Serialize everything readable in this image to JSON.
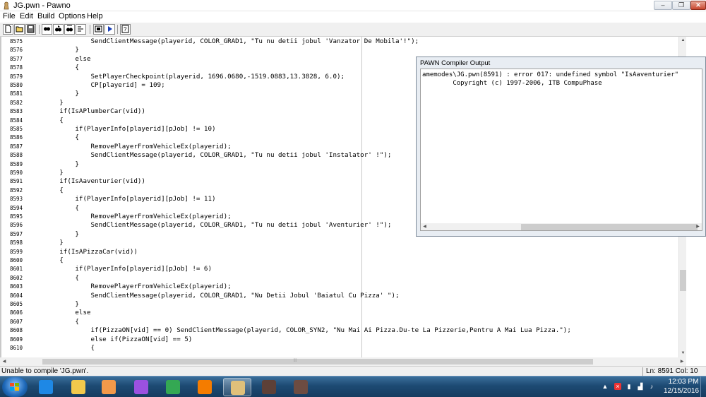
{
  "window": {
    "title": "JG.pwn - Pawno",
    "minimize": "–",
    "maximize": "❐",
    "close": "✕"
  },
  "menu": [
    "File",
    "Edit",
    "Build",
    "Options",
    "Help"
  ],
  "toolbar": {
    "buttons": [
      {
        "name": "new-file-icon",
        "glyph": "▫"
      },
      {
        "name": "open-file-icon",
        "glyph": "▭"
      },
      {
        "name": "save-icon",
        "glyph": "▪"
      },
      {
        "name": "find-icon",
        "glyph": "⚲"
      },
      {
        "name": "find-next-icon",
        "glyph": "⚲"
      },
      {
        "name": "replace-icon",
        "glyph": "⚲"
      },
      {
        "name": "goto-icon",
        "glyph": "⇥"
      },
      {
        "name": "function-list-icon",
        "glyph": "▣"
      },
      {
        "name": "compile-icon",
        "glyph": "▶"
      },
      {
        "name": "help-icon",
        "glyph": "?"
      }
    ]
  },
  "editor": {
    "lines": [
      {
        "n": "8575",
        "code": "                SendClientMessage(playerid, COLOR_GRAD1, \"Tu nu detii jobul 'Vanzator De Mobila'!\");"
      },
      {
        "n": "8576",
        "code": "            }"
      },
      {
        "n": "8577",
        "code": "            else"
      },
      {
        "n": "8578",
        "code": "            {"
      },
      {
        "n": "8579",
        "code": "                SetPlayerCheckpoint(playerid, 1696.0680,-1519.0883,13.3828, 6.0);"
      },
      {
        "n": "8580",
        "code": "                CP[playerid] = 109;"
      },
      {
        "n": "8581",
        "code": "            }"
      },
      {
        "n": "8582",
        "code": "        }"
      },
      {
        "n": "8583",
        "code": "        if(IsAPlumberCar(vid))"
      },
      {
        "n": "8584",
        "code": "        {"
      },
      {
        "n": "8585",
        "code": "            if(PlayerInfo[playerid][pJob] != 10)"
      },
      {
        "n": "8586",
        "code": "            {"
      },
      {
        "n": "8587",
        "code": "                RemovePlayerFromVehicleEx(playerid);"
      },
      {
        "n": "8588",
        "code": "                SendClientMessage(playerid, COLOR_GRAD1, \"Tu nu detii jobul 'Instalator' !\");"
      },
      {
        "n": "8589",
        "code": "            }"
      },
      {
        "n": "8590",
        "code": "        }"
      },
      {
        "n": "8591",
        "code": "        if(IsAaventurier(vid))"
      },
      {
        "n": "8592",
        "code": "        {"
      },
      {
        "n": "8593",
        "code": "            if(PlayerInfo[playerid][pJob] != 11)"
      },
      {
        "n": "8594",
        "code": "            {"
      },
      {
        "n": "8595",
        "code": "                RemovePlayerFromVehicleEx(playerid);"
      },
      {
        "n": "8596",
        "code": "                SendClientMessage(playerid, COLOR_GRAD1, \"Tu nu detii jobul 'Aventurier' !\");"
      },
      {
        "n": "8597",
        "code": "            }"
      },
      {
        "n": "8598",
        "code": "        }"
      },
      {
        "n": "8599",
        "code": "        if(IsAPizzaCar(vid))"
      },
      {
        "n": "8600",
        "code": "        {"
      },
      {
        "n": "8601",
        "code": "            if(PlayerInfo[playerid][pJob] != 6)"
      },
      {
        "n": "8602",
        "code": "            {"
      },
      {
        "n": "8603",
        "code": "                RemovePlayerFromVehicleEx(playerid);"
      },
      {
        "n": "8604",
        "code": "                SendClientMessage(playerid, COLOR_GRAD1, \"Nu Detii Jobul 'Baiatul Cu Pizza' \");"
      },
      {
        "n": "8605",
        "code": "            }"
      },
      {
        "n": "8606",
        "code": "            else"
      },
      {
        "n": "8607",
        "code": "            {"
      },
      {
        "n": "8608",
        "code": "                if(PizzaON[vid] == 0) SendClientMessage(playerid, COLOR_SYN2, \"Nu Mai Ai Pizza.Du-te La Pizzerie,Pentru A Mai Lua Pizza.\");"
      },
      {
        "n": "8609",
        "code": "                else if(PizzaON[vid] == 5)"
      },
      {
        "n": "8610",
        "code": "                {"
      }
    ]
  },
  "compiler_output": {
    "title": "PAWN Compiler Output",
    "lines": [
      "amemodes\\JG.pwn(8591) : error 017: undefined symbol \"IsAaventurier\"",
      "        Copyright (c) 1997-2006, ITB CompuPhase"
    ]
  },
  "status": {
    "message": "Unable to compile 'JG.pwn'.",
    "position": "Ln: 8591   Col: 10"
  },
  "taskbar": {
    "apps": [
      {
        "name": "internet-explorer-icon",
        "color": "#1e88e5"
      },
      {
        "name": "file-explorer-icon",
        "color": "#f2c94c"
      },
      {
        "name": "media-player-icon",
        "color": "#f2994a"
      },
      {
        "name": "paint-icon",
        "color": "#9b51e0"
      },
      {
        "name": "chrome-icon",
        "color": "#34a853"
      },
      {
        "name": "xampp-icon",
        "color": "#f57c00"
      },
      {
        "name": "pawno-icon",
        "color": "#e0c07a"
      },
      {
        "name": "gta-sa-icon",
        "color": "#5d4037"
      },
      {
        "name": "samp-icon",
        "color": "#6d4c41"
      }
    ],
    "time": "12:03 PM",
    "date": "12/15/2016"
  }
}
